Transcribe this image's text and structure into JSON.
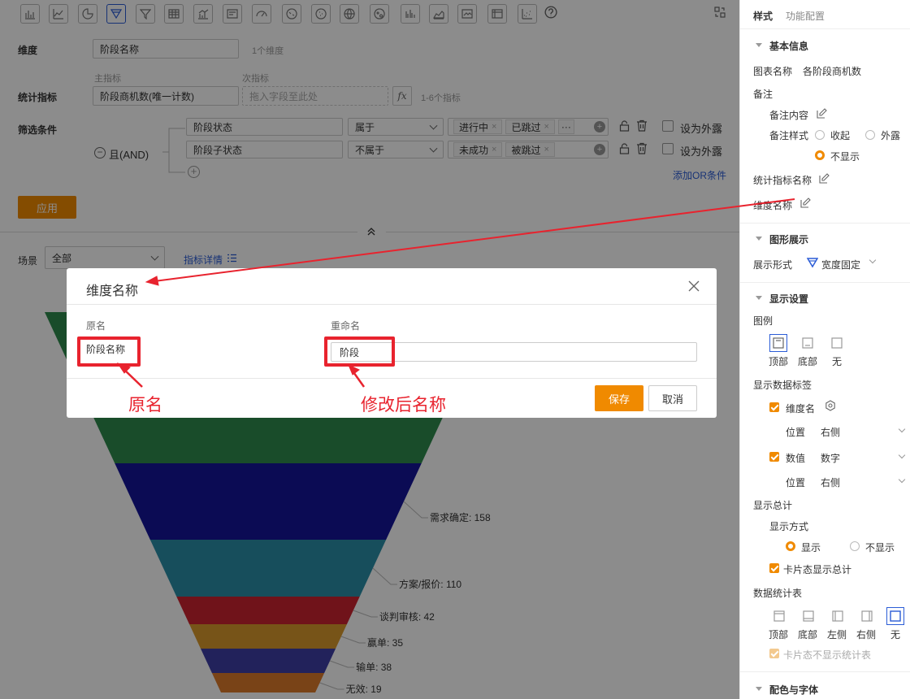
{
  "toolbar": {
    "icons": [
      "bar-chart-icon",
      "line-chart-icon",
      "pie-chart-icon",
      "funnel-icon",
      "filter-icon",
      "table-icon",
      "combo-chart-icon",
      "card-icon",
      "gauge-icon",
      "map-icon",
      "map-dots-icon",
      "globe-icon",
      "bubble-icon",
      "column-chart-icon",
      "area-chart-icon",
      "image-icon",
      "pivot-table-icon",
      "scatter-icon",
      "help-icon"
    ],
    "right_icon": "swap-icon"
  },
  "form": {
    "dimension_label": "维度",
    "dimension_value": "阶段名称",
    "dimension_hint": "1个维度",
    "metric_label": "统计指标",
    "primary_metric_caption": "主指标",
    "secondary_metric_caption": "次指标",
    "primary_metric_value": "阶段商机数(唯一计数)",
    "secondary_metric_placeholder": "拖入字段至此处",
    "fx_label": "fx",
    "metric_hint": "1-6个指标",
    "filter_label": "筛选条件",
    "logic_label": "且(AND)",
    "filters": [
      {
        "field": "阶段状态",
        "operator": "属于",
        "tags": [
          "进行中",
          "已跳过"
        ],
        "more": "···",
        "expose_label": "设为外露"
      },
      {
        "field": "阶段子状态",
        "operator": "不属于",
        "tags": [
          "未成功",
          "被跳过"
        ],
        "expose_label": "设为外露"
      }
    ],
    "add_or_label": "添加OR条件",
    "apply_label": "应用"
  },
  "scene": {
    "label": "场景",
    "value": "全部",
    "detail_link": "指标详情"
  },
  "chart_data": {
    "type": "funnel",
    "categories": [
      "需求确定",
      "方案/报价",
      "谈判审核",
      "赢单",
      "输单",
      "无效"
    ],
    "values": [
      158,
      110,
      42,
      35,
      38,
      19
    ],
    "labels": [
      "需求确定: 158",
      "方案/报价: 110",
      "谈判审核: 42",
      "赢单: 35",
      "输单: 38",
      "无效: 19"
    ],
    "colors": [
      "#2f8a4e",
      "#14159a",
      "#2a8fa8",
      "#cc2430",
      "#d99a2c",
      "#3e3fa7",
      "#dd7a2a"
    ]
  },
  "modal": {
    "title": "维度名称",
    "col_original": "原名",
    "col_rename": "重命名",
    "original_value": "阶段名称",
    "rename_value": "阶段",
    "save_label": "保存",
    "cancel_label": "取消"
  },
  "annotations": {
    "original_label": "原名",
    "renamed_label": "修改后名称"
  },
  "panel": {
    "tab_style": "样式",
    "tab_function": "功能配置",
    "basic_info": "基本信息",
    "chart_name_label": "图表名称",
    "chart_name_value": "各阶段商机数",
    "remark_label": "备注",
    "remark_content_label": "备注内容",
    "remark_style_label": "备注样式",
    "remark_style_options": [
      "收起",
      "外露",
      "不显示"
    ],
    "metric_name_label": "统计指标名称",
    "dimension_name_label": "维度名称",
    "graph_display": "图形展示",
    "display_form_label": "展示形式",
    "display_form_value": "宽度固定",
    "display_settings": "显示设置",
    "legend_label": "图例",
    "legend_options": [
      "顶部",
      "底部",
      "无"
    ],
    "data_label_title": "显示数据标签",
    "dimension_name_check": "维度名",
    "position_label": "位置",
    "position_value": "右侧",
    "value_check": "数值",
    "value_format": "数字",
    "position_value_2": "右侧",
    "total_label": "显示总计",
    "total_mode_label": "显示方式",
    "total_options": [
      "显示",
      "不显示"
    ],
    "card_total_label": "卡片态显示总计",
    "stats_table_label": "数据统计表",
    "stats_options": [
      "顶部",
      "底部",
      "左侧",
      "右侧",
      "无"
    ],
    "card_no_stats_label": "卡片态不显示统计表",
    "color_font": "配色与字体"
  }
}
